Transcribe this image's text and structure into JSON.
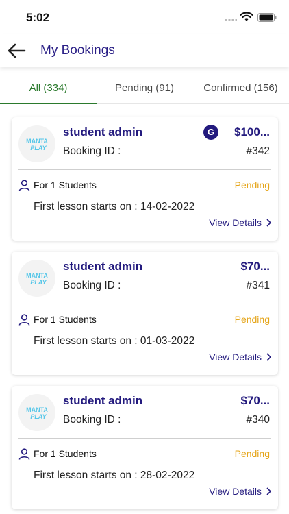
{
  "status_bar": {
    "time": "5:02"
  },
  "header": {
    "title": "My Bookings"
  },
  "tabs": [
    {
      "label": "All (334)",
      "active": true
    },
    {
      "label": "Pending (91)",
      "active": false
    },
    {
      "label": "Confirmed (156)",
      "active": false
    }
  ],
  "logo": {
    "line1": "MANTA",
    "line2": "PLAY"
  },
  "bookings": [
    {
      "name": "student admin",
      "price": "$100...",
      "badge": "G",
      "booking_label": "Booking ID :",
      "booking_id": "#342",
      "students": "For 1 Students",
      "status": "Pending",
      "lesson": "First lesson starts on : 14-02-2022",
      "view_label": "View Details"
    },
    {
      "name": "student admin",
      "price": "$70...",
      "booking_label": "Booking ID :",
      "booking_id": "#341",
      "students": "For 1 Students",
      "status": "Pending",
      "lesson": "First lesson starts on : 01-03-2022",
      "view_label": "View Details"
    },
    {
      "name": "student admin",
      "price": "$70...",
      "booking_label": "Booking ID :",
      "booking_id": "#340",
      "students": "For 1 Students",
      "status": "Pending",
      "lesson": "First lesson starts on : 28-02-2022",
      "view_label": "View Details"
    }
  ],
  "colors": {
    "brand": "#231a7e",
    "active_tab": "#2b7a2d",
    "pending": "#e5a51a"
  }
}
